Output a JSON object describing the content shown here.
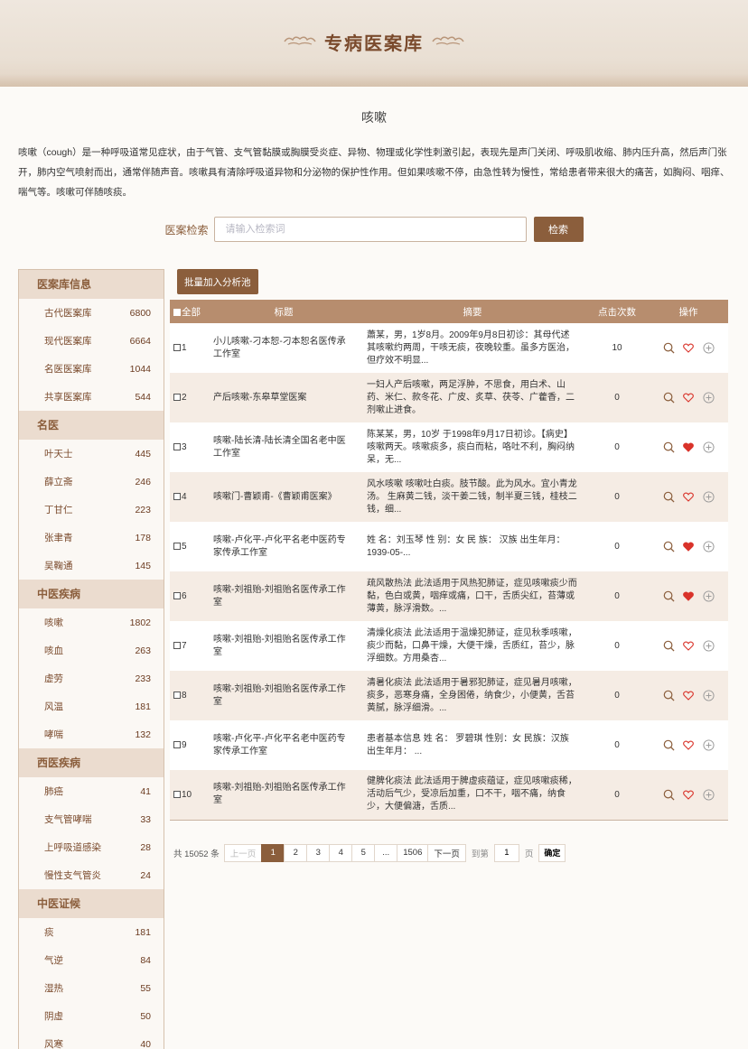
{
  "header": {
    "title": "专病医案库"
  },
  "topic": {
    "title": "咳嗽",
    "description": "咳嗽（cough）是一种呼吸道常见症状，由于气管、支气管黏膜或胸膜受炎症、异物、物理或化学性刺激引起，表现先是声门关闭、呼吸肌收缩、肺内压升高，然后声门张开，肺内空气喷射而出，通常伴随声音。咳嗽具有清除呼吸道异物和分泌物的保护性作用。但如果咳嗽不停，由急性转为慢性，常给患者带来很大的痛苦，如胸闷、咽痒、喘气等。咳嗽可伴随咳痰。"
  },
  "search": {
    "label": "医案检索",
    "placeholder": "请输入检索词",
    "button": "检索"
  },
  "sidebar": {
    "groups": [
      {
        "title": "医案库信息",
        "items": [
          {
            "label": "古代医案库",
            "count": "6800"
          },
          {
            "label": "现代医案库",
            "count": "6664"
          },
          {
            "label": "名医医案库",
            "count": "1044"
          },
          {
            "label": "共享医案库",
            "count": "544"
          }
        ]
      },
      {
        "title": "名医",
        "items": [
          {
            "label": "叶天士",
            "count": "445"
          },
          {
            "label": "薛立斋",
            "count": "246"
          },
          {
            "label": "丁甘仁",
            "count": "223"
          },
          {
            "label": "张聿青",
            "count": "178"
          },
          {
            "label": "吴鞠通",
            "count": "145"
          }
        ]
      },
      {
        "title": "中医疾病",
        "items": [
          {
            "label": "咳嗽",
            "count": "1802"
          },
          {
            "label": "咳血",
            "count": "263"
          },
          {
            "label": "虚劳",
            "count": "233"
          },
          {
            "label": "风温",
            "count": "181"
          },
          {
            "label": "哮喘",
            "count": "132"
          }
        ]
      },
      {
        "title": "西医疾病",
        "items": [
          {
            "label": "肺癌",
            "count": "41"
          },
          {
            "label": "支气管哮喘",
            "count": "33"
          },
          {
            "label": "上呼吸道感染",
            "count": "28"
          },
          {
            "label": "慢性支气管炎",
            "count": "24"
          }
        ]
      },
      {
        "title": "中医证候",
        "items": [
          {
            "label": "痰",
            "count": "181"
          },
          {
            "label": "气逆",
            "count": "84"
          },
          {
            "label": "湿热",
            "count": "55"
          },
          {
            "label": "阴虚",
            "count": "50"
          },
          {
            "label": "风寒",
            "count": "40"
          }
        ]
      }
    ]
  },
  "main": {
    "batch_button": "批量加入分析池",
    "table": {
      "headers": {
        "all": "全部",
        "title": "标题",
        "abstract": "摘要",
        "clicks": "点击次数",
        "ops": "操作"
      },
      "rows": [
        {
          "no": "1",
          "title": "小儿咳嗽-刁本恕-刁本恕名医传承工作室",
          "abstract": "蕭某，男，1岁8月。2009年9月8日初诊：其母代述其咳嗽约两周，干咳无痰，夜晚较重。虽多方医治，但疗效不明显...",
          "clicks": "10",
          "fav": false
        },
        {
          "no": "2",
          "title": "产后咳嗽-东皋草堂医案",
          "abstract": "一妇人产后咳嗽，两足浮肿，不思食，用白术、山药、米仁、款冬花、广皮、炙草、茯苓、广藿香，二剂嗽止进食。",
          "clicks": "0",
          "fav": false
        },
        {
          "no": "3",
          "title": "咳嗽-陆长清-陆长清全国名老中医工作室",
          "abstract": "陈某某，男，10岁 于1998年9月17日初诊。【病史】咳嗽两天。咳嗽痰多，痰白而粘，咯吐不利，胸闷纳呆，无...",
          "clicks": "0",
          "fav": true
        },
        {
          "no": "4",
          "title": "咳嗽门-曹颖甫-《曹颖甫医案》",
          "abstract": "风水咳嗽 咳嗽吐白痰。肢节酸。此为风水。宜小青龙汤。 生麻黄二钱，淡干姜二钱，制半夏三钱，桂枝二钱，细...",
          "clicks": "0",
          "fav": false
        },
        {
          "no": "5",
          "title": "咳嗽-卢化平-卢化平名老中医药专家传承工作室",
          "abstract": "姓 名：刘玉琴 性 别：女 民 族： 汉族 出生年月：1939-05-...",
          "clicks": "0",
          "fav": true
        },
        {
          "no": "6",
          "title": "咳嗽-刘祖贻-刘祖贻名医传承工作室",
          "abstract": "疏风散热法 此法适用于风热犯肺证，症见咳嗽痰少而黏，色白或黄，咽痒或痛，口干，舌质尖红，苔薄或薄黄，脉浮滑数。...",
          "clicks": "0",
          "fav": true
        },
        {
          "no": "7",
          "title": "咳嗽-刘祖贻-刘祖贻名医传承工作室",
          "abstract": "清燥化痰法 此法适用于温燥犯肺证，症见秋季咳嗽，痰少而黏，口鼻干燥，大便干燥，舌质红，苔少，脉浮细数。方用桑杏...",
          "clicks": "0",
          "fav": false
        },
        {
          "no": "8",
          "title": "咳嗽-刘祖贻-刘祖贻名医传承工作室",
          "abstract": "清暑化痰法 此法适用于暑邪犯肺证，症见暑月咳嗽，痰多，恶寒身痛，全身困倦，纳食少，小便黄，舌苔黄腻，脉浮细滑。...",
          "clicks": "0",
          "fav": false
        },
        {
          "no": "9",
          "title": "咳嗽-卢化平-卢化平名老中医药专家传承工作室",
          "abstract": "患者基本信息 姓 名： 罗碧琪 性别：女 民族：汉族 出生年月： ...",
          "clicks": "0",
          "fav": false
        },
        {
          "no": "10",
          "title": "咳嗽-刘祖贻-刘祖贻名医传承工作室",
          "abstract": "健脾化痰法 此法适用于脾虚痰蕴证，症见咳嗽痰稀，活动后气少，受凉后加重，口不干，咽不痛，纳食少，大便偏溏，舌质...",
          "clicks": "0",
          "fav": false
        }
      ]
    },
    "pagination": {
      "total": "共 15052 条",
      "prev": "上一页",
      "pages": [
        "1",
        "2",
        "3",
        "4",
        "5",
        "...",
        "1506"
      ],
      "active": "1",
      "next": "下一页",
      "goto_label": "到第",
      "goto_value": "1",
      "page_unit": "页",
      "confirm": "确定"
    }
  },
  "colors": {
    "accent": "#8b5e3c",
    "header_row": "#b78d6e",
    "heart": "#d9332a",
    "group_bg": "#ebdccf"
  }
}
